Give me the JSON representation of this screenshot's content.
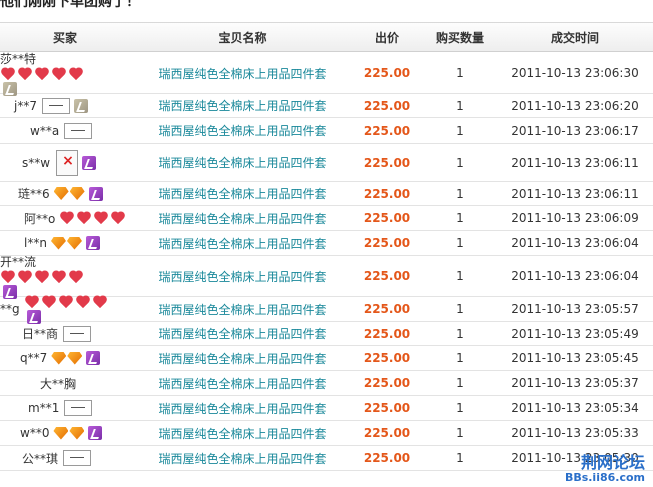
{
  "page_title": "他们刚刚下单团购了！",
  "columns": [
    "买家",
    "宝贝名称",
    "出价",
    "购买数量",
    "成交时间"
  ],
  "colors": {
    "item_link": "#19889a",
    "price": "#e4571a",
    "heart": "#e23a4a",
    "vip": "#7a2ea8"
  },
  "rows": [
    {
      "buyer": "莎**特",
      "badges": [
        "heart",
        "heart",
        "heart",
        "heart",
        "heart",
        "vip-gray"
      ],
      "item": "瑞西屋纯色全棉床上用品四件套",
      "price": "225.00",
      "qty": "1",
      "time": "2011-10-13 23:06:30"
    },
    {
      "buyer": "j**7",
      "badges": [
        "newbie",
        "vip-gray"
      ],
      "item": "瑞西屋纯色全棉床上用品四件套",
      "price": "225.00",
      "qty": "1",
      "time": "2011-10-13 23:06:20"
    },
    {
      "buyer": "w**a",
      "badges": [
        "newbie"
      ],
      "item": "瑞西屋纯色全棉床上用品四件套",
      "price": "225.00",
      "qty": "1",
      "time": "2011-10-13 23:06:17"
    },
    {
      "buyer": "s**w",
      "badges": [
        "broken-image",
        "vip"
      ],
      "item": "瑞西屋纯色全棉床上用品四件套",
      "price": "225.00",
      "qty": "1",
      "time": "2011-10-13 23:06:11"
    },
    {
      "buyer": "琏**6",
      "badges": [
        "diamond",
        "diamond",
        "vip"
      ],
      "item": "瑞西屋纯色全棉床上用品四件套",
      "price": "225.00",
      "qty": "1",
      "time": "2011-10-13 23:06:11"
    },
    {
      "buyer": "阿**o",
      "badges": [
        "heart",
        "heart",
        "heart",
        "heart"
      ],
      "item": "瑞西屋纯色全棉床上用品四件套",
      "price": "225.00",
      "qty": "1",
      "time": "2011-10-13 23:06:09"
    },
    {
      "buyer": "l**n",
      "badges": [
        "diamond",
        "diamond",
        "vip"
      ],
      "item": "瑞西屋纯色全棉床上用品四件套",
      "price": "225.00",
      "qty": "1",
      "time": "2011-10-13 23:06:04"
    },
    {
      "buyer": "开**流",
      "badges": [
        "heart",
        "heart",
        "heart",
        "heart",
        "heart",
        "vip"
      ],
      "item": "瑞西屋纯色全棉床上用品四件套",
      "price": "225.00",
      "qty": "1",
      "time": "2011-10-13 23:06:04"
    },
    {
      "buyer": "**g",
      "badges": [
        "heart",
        "heart",
        "heart",
        "heart",
        "heart",
        "vip"
      ],
      "item": "瑞西屋纯色全棉床上用品四件套",
      "price": "225.00",
      "qty": "1",
      "time": "2011-10-13 23:05:57"
    },
    {
      "buyer": "日**商",
      "badges": [
        "newbie"
      ],
      "item": "瑞西屋纯色全棉床上用品四件套",
      "price": "225.00",
      "qty": "1",
      "time": "2011-10-13 23:05:49"
    },
    {
      "buyer": "q**7",
      "badges": [
        "diamond",
        "diamond",
        "vip"
      ],
      "item": "瑞西屋纯色全棉床上用品四件套",
      "price": "225.00",
      "qty": "1",
      "time": "2011-10-13 23:05:45"
    },
    {
      "buyer": "大**胸",
      "badges": [],
      "item": "瑞西屋纯色全棉床上用品四件套",
      "price": "225.00",
      "qty": "1",
      "time": "2011-10-13 23:05:37"
    },
    {
      "buyer": "m**1",
      "badges": [
        "newbie"
      ],
      "item": "瑞西屋纯色全棉床上用品四件套",
      "price": "225.00",
      "qty": "1",
      "time": "2011-10-13 23:05:34"
    },
    {
      "buyer": "w**0",
      "badges": [
        "diamond",
        "diamond",
        "vip"
      ],
      "item": "瑞西屋纯色全棉床上用品四件套",
      "price": "225.00",
      "qty": "1",
      "time": "2011-10-13 23:05:33"
    },
    {
      "buyer": "公**琪",
      "badges": [
        "newbie"
      ],
      "item": "瑞西屋纯色全棉床上用品四件套",
      "price": "225.00",
      "qty": "1",
      "time": "2011-10-13 23:05:30"
    }
  ],
  "watermark": {
    "title": "荆网论坛",
    "url": "BBs.ii86.com"
  }
}
